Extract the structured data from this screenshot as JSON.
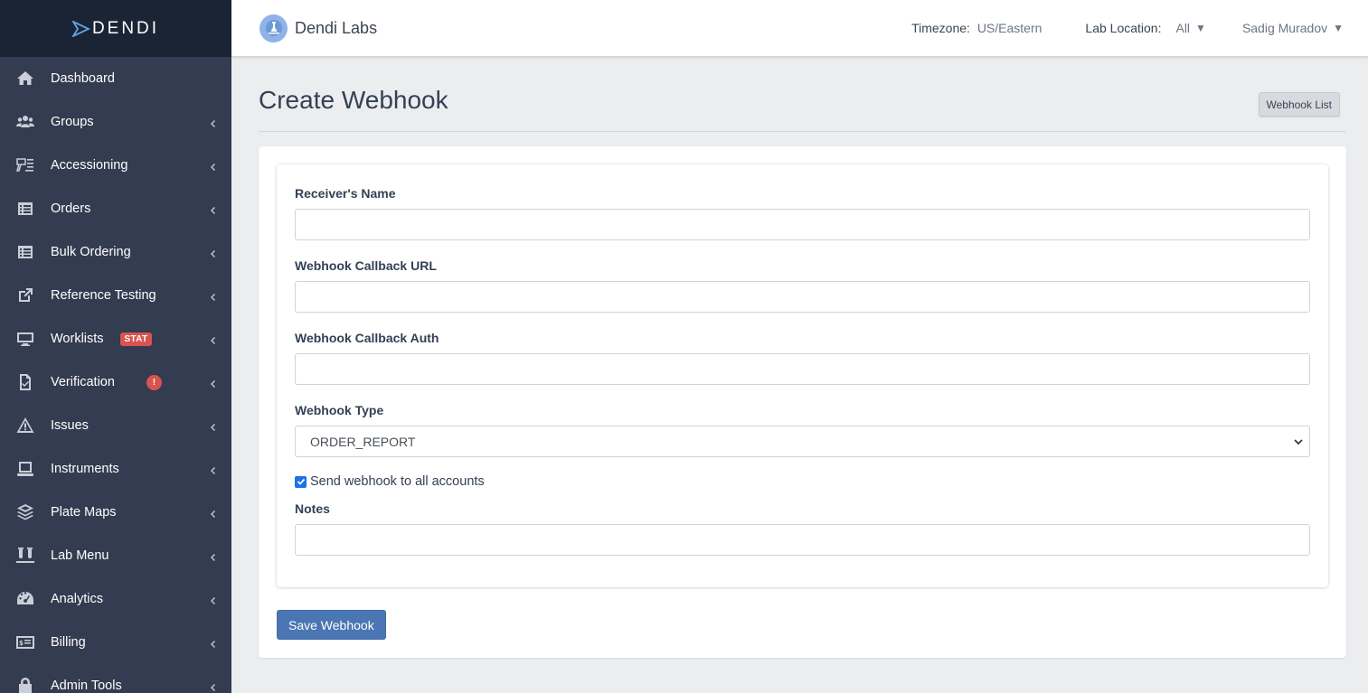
{
  "brand": {
    "name": "DENDI"
  },
  "sidebar": {
    "items": [
      {
        "label": "Dashboard",
        "icon": "home-icon"
      },
      {
        "label": "Groups",
        "icon": "users-icon"
      },
      {
        "label": "Accessioning",
        "icon": "accessioning-icon"
      },
      {
        "label": "Orders",
        "icon": "list-icon"
      },
      {
        "label": "Bulk Ordering",
        "icon": "list-icon"
      },
      {
        "label": "Reference Testing",
        "icon": "external-link-icon"
      },
      {
        "label": "Worklists",
        "icon": "monitor-icon",
        "badge": "STAT"
      },
      {
        "label": "Verification",
        "icon": "file-check-icon",
        "badge": "!"
      },
      {
        "label": "Issues",
        "icon": "warning-icon"
      },
      {
        "label": "Instruments",
        "icon": "laptop-icon"
      },
      {
        "label": "Plate Maps",
        "icon": "layers-icon"
      },
      {
        "label": "Lab Menu",
        "icon": "test-tubes-icon"
      },
      {
        "label": "Analytics",
        "icon": "gauge-icon"
      },
      {
        "label": "Billing",
        "icon": "money-icon"
      },
      {
        "label": "Admin Tools",
        "icon": "lock-icon"
      }
    ]
  },
  "header": {
    "lab_name": "Dendi Labs",
    "timezone_label": "Timezone:",
    "timezone_value": "US/Eastern",
    "location_label": "Lab Location:",
    "location_value": "All",
    "user_name": "Sadig Muradov"
  },
  "page": {
    "title": "Create Webhook",
    "list_button": "Webhook List"
  },
  "form": {
    "receiver_name_label": "Receiver's Name",
    "receiver_name_value": "",
    "callback_url_label": "Webhook Callback URL",
    "callback_url_value": "",
    "callback_auth_label": "Webhook Callback Auth",
    "callback_auth_value": "",
    "type_label": "Webhook Type",
    "type_value": "ORDER_REPORT",
    "send_all_label": "Send webhook to all accounts",
    "send_all_checked": true,
    "notes_label": "Notes",
    "notes_value": "",
    "save_button": "Save Webhook"
  },
  "colors": {
    "sidebar_bg": "#333c50",
    "brand_bg": "#1b2435",
    "primary_button": "#4a76b3",
    "badge_red": "#d9534f"
  }
}
